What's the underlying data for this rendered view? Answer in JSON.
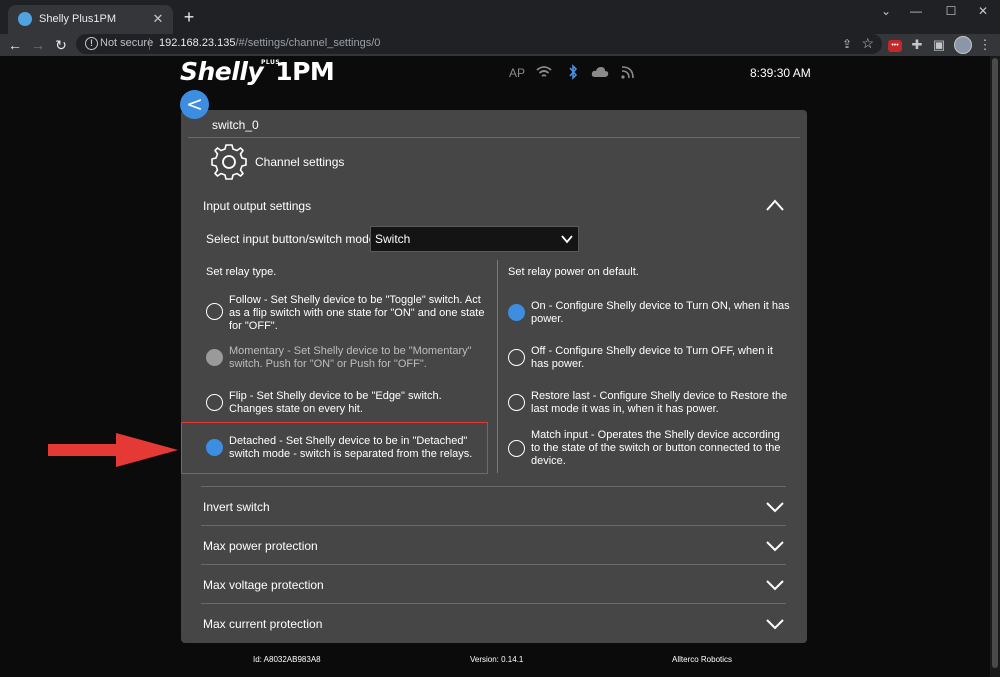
{
  "browser": {
    "tab_title": "Shelly Plus1PM",
    "new_tab": "+",
    "not_secure": "Not secure",
    "url_host": "192.168.23.135",
    "url_path": "/#/settings/channel_settings/0"
  },
  "header": {
    "logo_main": "Shelly",
    "logo_plus": "PLUS",
    "logo_model": "1PM",
    "ap_label": "AP",
    "time": "8:39:30 AM"
  },
  "card": {
    "title": "switch_0",
    "section": "Channel settings",
    "input_output": {
      "heading": "Input output settings",
      "mode_label": "Select input button/switch mode.",
      "mode_value": "Switch",
      "relay_type": {
        "heading": "Set relay type.",
        "options": [
          {
            "text": "Follow - Set Shelly device to be \"Toggle\" switch. Act as a flip switch with one state for \"ON\" and one state for \"OFF\".",
            "state": "off"
          },
          {
            "text": "Momentary - Set Shelly device to be \"Momentary\" switch. Push for \"ON\" or Push for \"OFF\".",
            "state": "disabled"
          },
          {
            "text": "Flip - Set Shelly device to be \"Edge\" switch. Changes state on every hit.",
            "state": "off"
          },
          {
            "text": "Detached - Set Shelly device to be in \"Detached\" switch mode - switch is separated from the relays.",
            "state": "on"
          }
        ]
      },
      "power_on": {
        "heading": "Set relay power on default.",
        "options": [
          {
            "text": "On - Configure Shelly device to Turn ON, when it has power.",
            "state": "on"
          },
          {
            "text": "Off - Configure Shelly device to Turn OFF, when it has power.",
            "state": "off"
          },
          {
            "text": "Restore last - Configure Shelly device to Restore the last mode it was in, when it has power.",
            "state": "off"
          },
          {
            "text": "Match input - Operates the Shelly device according to the state of the switch or button connected to the device.",
            "state": "off"
          }
        ]
      }
    },
    "accordions": [
      "Invert switch",
      "Max power protection",
      "Max voltage protection",
      "Max current protection"
    ]
  },
  "footer": {
    "id": "Id: A8032AB983A8",
    "version": "Version: 0.14.1",
    "company": "Allterco Robotics"
  },
  "colors": {
    "accent": "#3d8de0",
    "card": "#464646",
    "highlight": "#e53935"
  }
}
